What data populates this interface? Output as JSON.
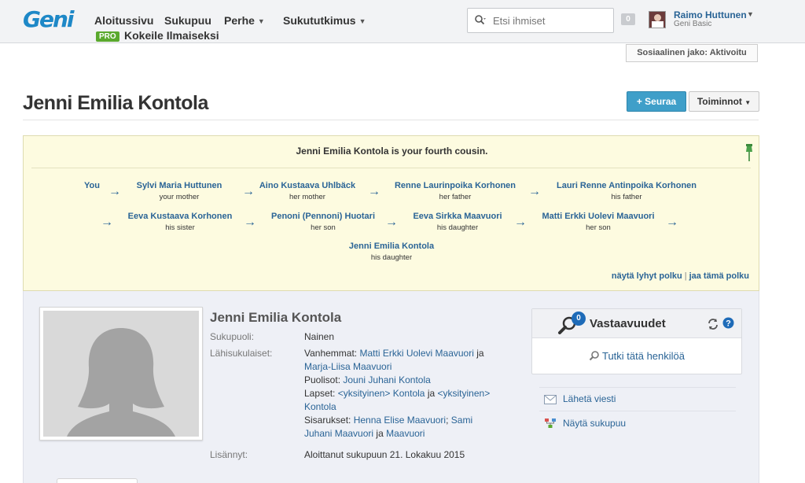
{
  "header": {
    "logo": "Geni",
    "nav": [
      {
        "label": "Aloitussivu",
        "caret": false
      },
      {
        "label": "Sukupuu",
        "caret": false
      },
      {
        "label": "Perhe",
        "caret": true
      },
      {
        "label": "Sukututkimus",
        "caret": true
      }
    ],
    "pro_badge": "PRO",
    "pro_text": "Kokeile Ilmaiseksi",
    "search_placeholder": "Etsi ihmiset",
    "notification_count": "0",
    "user_name": "Raimo Huttunen",
    "user_plan": "Geni Basic"
  },
  "social_share": "Sosiaalinen jako: Aktivoitu",
  "profile_title": "Jenni Emilia Kontola",
  "buttons": {
    "follow": "+ Seuraa",
    "actions": "Toiminnot"
  },
  "relationship": {
    "headline": "Jenni Emilia Kontola is your fourth cousin.",
    "path": [
      {
        "name": "You",
        "role": ""
      },
      {
        "name": "Sylvi Maria Huttunen",
        "role": "your mother"
      },
      {
        "name": "Aino Kustaava Uhlbäck",
        "role": "her mother"
      },
      {
        "name": "Renne Laurinpoika Korhonen",
        "role": "her father"
      },
      {
        "name": "Lauri Renne Antinpoika Korhonen",
        "role": "his father"
      },
      {
        "name": "Eeva Kustaava Korhonen",
        "role": "his sister"
      },
      {
        "name": "Penoni (Pennoni) Huotari",
        "role": "her son"
      },
      {
        "name": "Eeva Sirkka Maavuori",
        "role": "his daughter"
      },
      {
        "name": "Matti Erkki Uolevi Maavuori",
        "role": "her son"
      },
      {
        "name": "Jenni Emilia Kontola",
        "role": "his daughter"
      }
    ],
    "arrow": "→",
    "link_short": "näytä lyhyt polku",
    "link_share": "jaa tämä polku",
    "link_sep": "|"
  },
  "profile": {
    "name": "Jenni Emilia Kontola",
    "gender_label": "Sukupuoli:",
    "gender_value": "Nainen",
    "relatives_label": "Lähisukulaiset:",
    "parents_label": "Vanhemmat:",
    "parent1": "Matti Erkki Uolevi Maavuori",
    "and": "ja",
    "parent2": "Marja-Liisa Maavuori",
    "spouses_label": "Puolisot:",
    "spouse1": "Jouni Juhani Kontola",
    "children_label": "Lapset:",
    "child1": "<yksityinen> Kontola",
    "child2": "<yksityinen> Kontola",
    "siblings_label": "Sisarukset:",
    "sibling1": "Henna Elise Maavuori",
    "sibling_sep": ";",
    "sibling2": "Sami Juhani Maavuori",
    "sibling3": "Maavuori",
    "added_label": "Lisännyt:",
    "added_value": "Aloittanut sukupuun 21. Lokakuu 2015"
  },
  "matches": {
    "count": "0",
    "title": "Vastaavuudet",
    "research_link": "Tutki tätä henkilöä"
  },
  "side_links": {
    "message": "Lähetä viesti",
    "tree": "Näytä sukupuu"
  }
}
